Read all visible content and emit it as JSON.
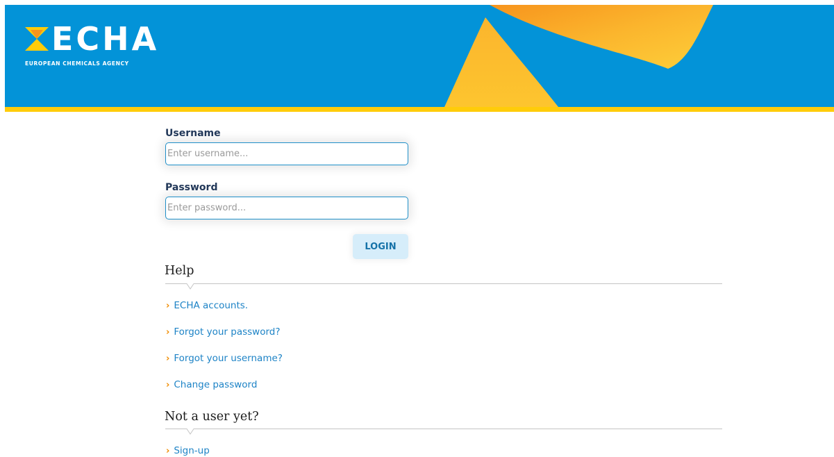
{
  "header": {
    "logo_text": "ECHA",
    "logo_subtitle": "EUROPEAN CHEMICALS AGENCY",
    "banner_color": "#0393d8",
    "accent_color": "#ffcc0a"
  },
  "login_form": {
    "username_label": "Username",
    "username_placeholder": "Enter username...",
    "username_value": "",
    "password_label": "Password",
    "password_placeholder": "Enter password...",
    "password_value": "",
    "login_button": "LOGIN"
  },
  "help": {
    "title": "Help",
    "links": [
      {
        "label": "ECHA accounts."
      },
      {
        "label": "Forgot your password?"
      },
      {
        "label": "Forgot your username?"
      },
      {
        "label": "Change password"
      }
    ]
  },
  "signup": {
    "title": "Not a user yet?",
    "link": "Sign-up"
  },
  "icons": {
    "bullet": "chevron-right-icon"
  }
}
